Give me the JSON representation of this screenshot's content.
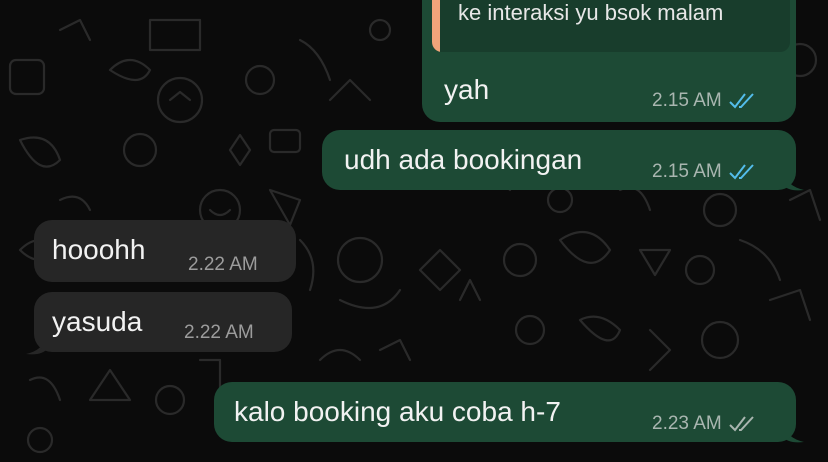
{
  "quoted_reply": {
    "text": "ke interaksi yu bsok malam"
  },
  "messages": [
    {
      "direction": "outgoing",
      "text": "yah",
      "time": "2.15 AM",
      "status": "read"
    },
    {
      "direction": "outgoing",
      "text": "udh ada bookingan",
      "time": "2.15 AM",
      "status": "read"
    },
    {
      "direction": "incoming",
      "text": "hooohh",
      "time": "2.22 AM"
    },
    {
      "direction": "incoming",
      "text": "yasuda",
      "time": "2.22 AM"
    },
    {
      "direction": "outgoing",
      "text": "kalo booking aku coba h-7",
      "time": "2.23 AM",
      "status": "delivered"
    }
  ],
  "colors": {
    "background": "#0b0b0b",
    "outgoing_bubble": "#1d4a35",
    "incoming_bubble": "#262626",
    "read_ticks": "#53bdeb",
    "delivered_ticks": "#a9b6b0",
    "quote_accent": "#f0a47a"
  }
}
